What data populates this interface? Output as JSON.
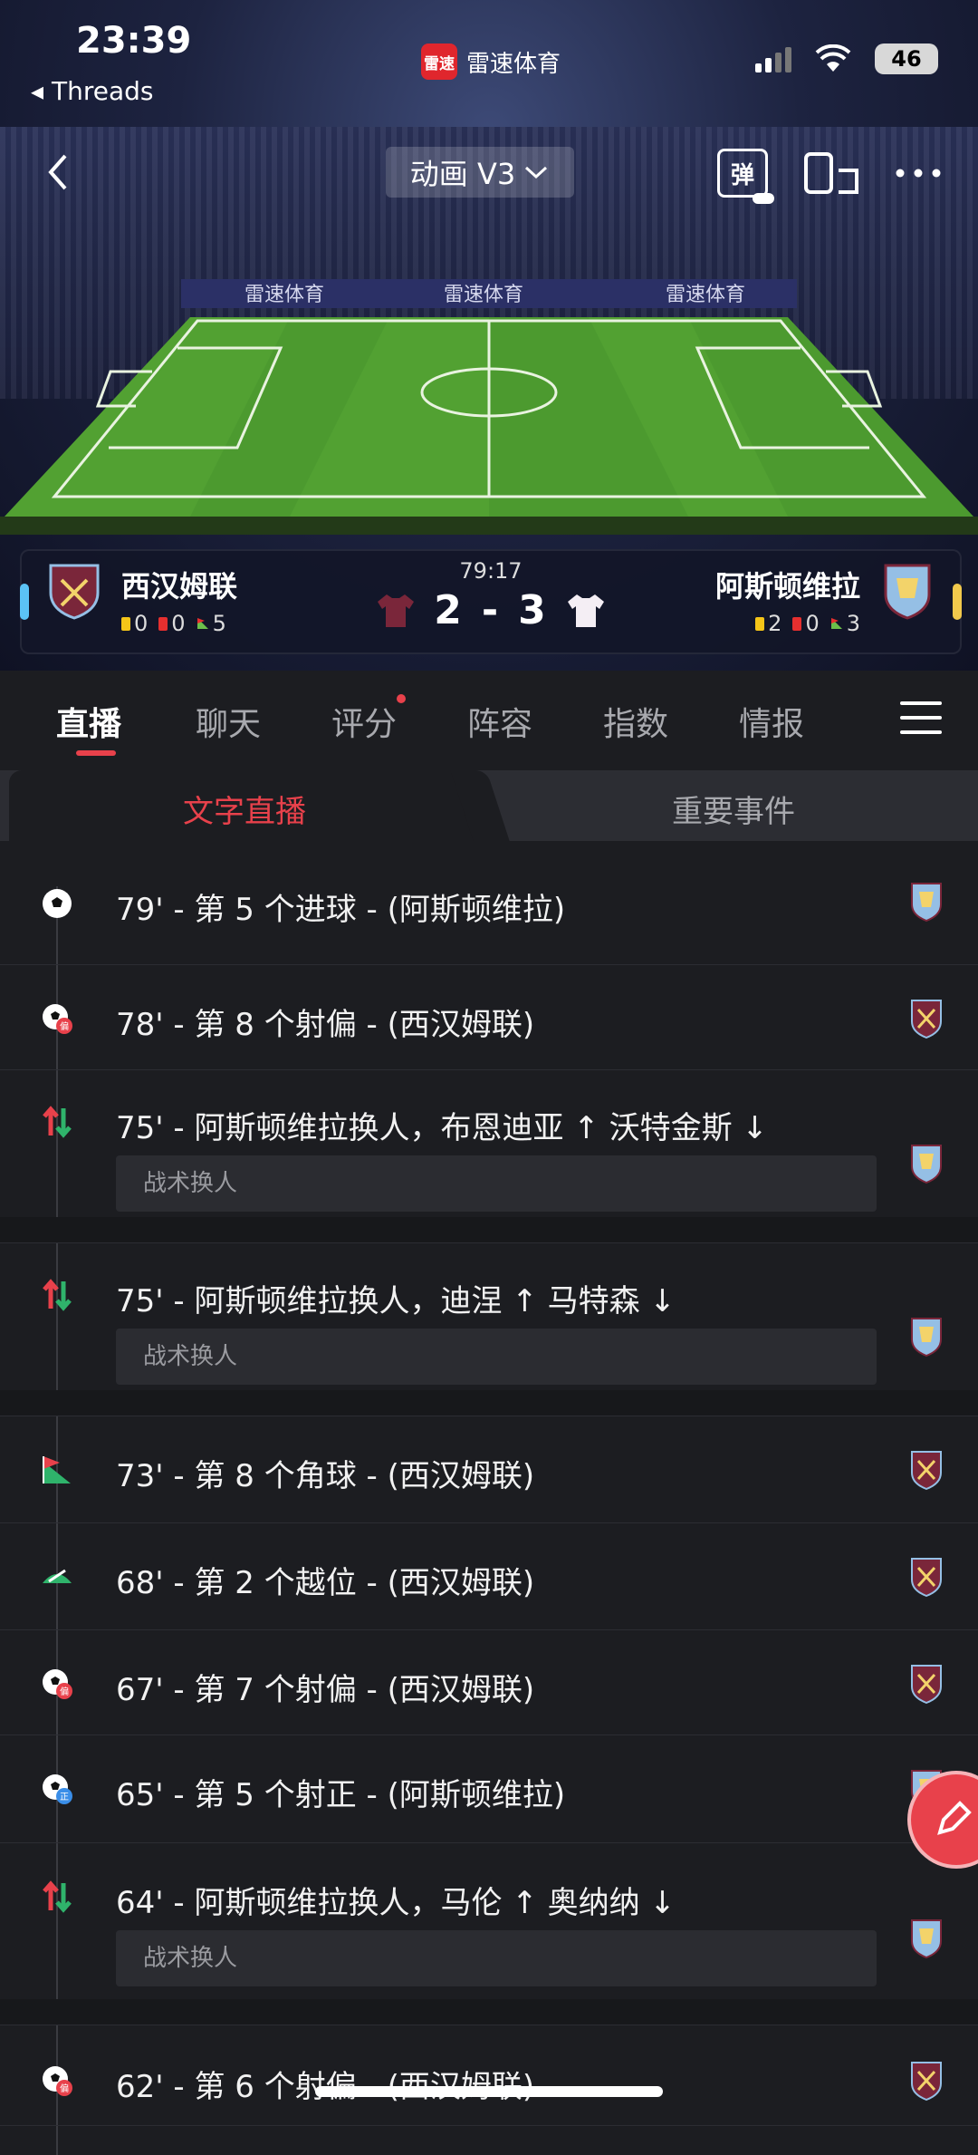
{
  "status_bar": {
    "time": "23:39",
    "back_app": "Threads",
    "app_name": "雷速体育",
    "app_logo_text": "雷速",
    "battery": "46"
  },
  "nav": {
    "mode_label": "动画 V3",
    "danmaku_label": "弹"
  },
  "pitch": {
    "board_text": "雷速体育"
  },
  "match": {
    "time": "79:17",
    "home": {
      "name": "西汉姆联",
      "yellow": "0",
      "red": "0",
      "corners": "5",
      "color": "#7a263a"
    },
    "away": {
      "name": "阿斯顿维拉",
      "yellow": "2",
      "red": "0",
      "corners": "3",
      "color": "#95bfe5"
    },
    "home_score": "2",
    "separator": "-",
    "away_score": "3"
  },
  "tabs": [
    {
      "label": "直播",
      "active": true
    },
    {
      "label": "聊天"
    },
    {
      "label": "评分",
      "dot": true
    },
    {
      "label": "阵容"
    },
    {
      "label": "指数"
    },
    {
      "label": "情报"
    }
  ],
  "subtabs": {
    "left": "文字直播",
    "right": "重要事件"
  },
  "events": [
    {
      "text": "79' - 第 5 个进球 - (阿斯顿维拉)",
      "icon": "goal-icon",
      "team": "away"
    },
    {
      "text": "78' - 第 8 个射偏 - (西汉姆联)",
      "icon": "shot-off-target-icon",
      "team": "home"
    },
    {
      "text": "75' - 阿斯顿维拉换人，布恩迪亚 ↑ 沃特金斯 ↓",
      "icon": "substitution-icon",
      "team": "away",
      "sub": "战术换人"
    },
    {
      "text": "75' - 阿斯顿维拉换人，迪涅 ↑ 马特森 ↓",
      "icon": "substitution-icon",
      "team": "away",
      "sub": "战术换人"
    },
    {
      "text": "73' - 第 8 个角球 - (西汉姆联)",
      "icon": "corner-flag-icon",
      "team": "home"
    },
    {
      "text": "68' - 第 2 个越位 - (西汉姆联)",
      "icon": "offside-icon",
      "team": "home"
    },
    {
      "text": "67' - 第 7 个射偏 - (西汉姆联)",
      "icon": "shot-off-target-icon",
      "team": "home"
    },
    {
      "text": "65' - 第 5 个射正 - (阿斯顿维拉)",
      "icon": "shot-on-target-icon",
      "team": "away"
    },
    {
      "text": "64' - 阿斯顿维拉换人，马伦 ↑ 奥纳纳 ↓",
      "icon": "substitution-icon",
      "team": "away",
      "sub": "战术换人"
    },
    {
      "text": "62' - 第 6 个射偏 - (西汉姆联)",
      "icon": "shot-off-target-icon",
      "team": "home"
    }
  ],
  "icon_badges": {
    "off_target": "偏",
    "on_target": "正"
  },
  "colors": {
    "accent": "#e8414b",
    "background": "#1c1d21",
    "pitch": "#4c9a2f"
  }
}
